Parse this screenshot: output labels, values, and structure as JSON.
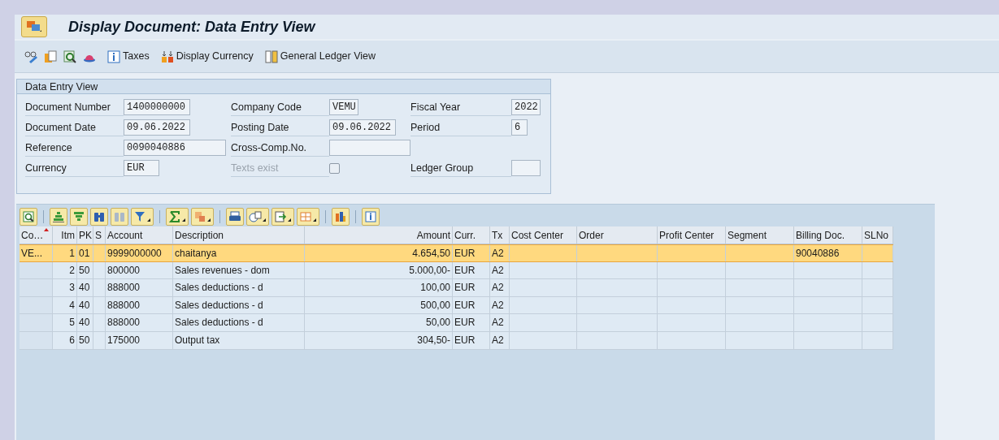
{
  "window": {
    "title": "Display Document: Data Entry View"
  },
  "toolbar": [
    {
      "kind": "icon"
    },
    {
      "kind": "icon"
    },
    {
      "kind": "icon"
    },
    {
      "kind": "icon"
    },
    {
      "kind": "button",
      "label": "Taxes"
    },
    {
      "kind": "button",
      "label": "Display Currency"
    },
    {
      "kind": "button",
      "label": "General Ledger View"
    }
  ],
  "header_group": {
    "title": "Data Entry View",
    "rows": [
      [
        {
          "kind": "field",
          "label": "Document Number",
          "value": "1400000000"
        },
        {
          "kind": "field",
          "label": "Company Code",
          "value": "VEMU"
        },
        {
          "kind": "field",
          "label": "Fiscal Year",
          "value": "2022"
        }
      ],
      [
        {
          "kind": "field",
          "label": "Document Date",
          "value": "09.06.2022"
        },
        {
          "kind": "field",
          "label": "Posting Date",
          "value": "09.06.2022"
        },
        {
          "kind": "field",
          "label": "Period",
          "value": "6"
        }
      ],
      [
        {
          "kind": "field",
          "label": "Reference",
          "value": "0090040886"
        },
        {
          "kind": "field",
          "label": "Cross-Comp.No."
        }
      ],
      [
        {
          "kind": "field",
          "label": "Currency",
          "value": "EUR"
        },
        {
          "kind": "checkbox",
          "label": "Texts exist",
          "checked": false,
          "disabled": true
        },
        {
          "kind": "field",
          "label": "Ledger Group"
        }
      ]
    ]
  },
  "table": {
    "columns": [
      {
        "label": "Co…",
        "sorted": true
      },
      {
        "label": "Itm",
        "sorted": false
      },
      {
        "label": "PK",
        "sorted": false
      },
      {
        "label": "S",
        "sorted": false
      },
      {
        "label": "Account",
        "sorted": false
      },
      {
        "label": "Description",
        "sorted": false
      },
      {
        "label": "Amount",
        "sorted": false
      },
      {
        "label": "Curr.",
        "sorted": false
      },
      {
        "label": "Tx",
        "sorted": false
      },
      {
        "label": "Cost Center",
        "sorted": false
      },
      {
        "label": "Order",
        "sorted": false
      },
      {
        "label": "Profit Center",
        "sorted": false
      },
      {
        "label": "Segment",
        "sorted": false
      },
      {
        "label": "Billing Doc.",
        "sorted": false
      },
      {
        "label": "SLNo",
        "sorted": false
      }
    ],
    "rows": [
      {
        "selected": true,
        "cells": [
          "VE...",
          "1",
          "01",
          "",
          "9999000000",
          "chaitanya",
          "4.654,50",
          "EUR",
          "A2",
          "",
          "",
          "",
          "",
          "90040886",
          ""
        ]
      },
      {
        "selected": false,
        "cells": [
          "",
          "2",
          "50",
          "",
          "800000",
          "Sales revenues - dom",
          "5.000,00-",
          "EUR",
          "A2",
          "",
          "",
          "",
          "",
          "",
          ""
        ]
      },
      {
        "selected": false,
        "cells": [
          "",
          "3",
          "40",
          "",
          "888000",
          "Sales deductions - d",
          "100,00",
          "EUR",
          "A2",
          "",
          "",
          "",
          "",
          "",
          ""
        ]
      },
      {
        "selected": false,
        "cells": [
          "",
          "4",
          "40",
          "",
          "888000",
          "Sales deductions - d",
          "500,00",
          "EUR",
          "A2",
          "",
          "",
          "",
          "",
          "",
          ""
        ]
      },
      {
        "selected": false,
        "cells": [
          "",
          "5",
          "40",
          "",
          "888000",
          "Sales deductions - d",
          "50,00",
          "EUR",
          "A2",
          "",
          "",
          "",
          "",
          "",
          ""
        ]
      },
      {
        "selected": false,
        "cells": [
          "",
          "6",
          "50",
          "",
          "175000",
          "Output tax",
          "304,50-",
          "EUR",
          "A2",
          "",
          "",
          "",
          "",
          "",
          ""
        ]
      }
    ]
  }
}
